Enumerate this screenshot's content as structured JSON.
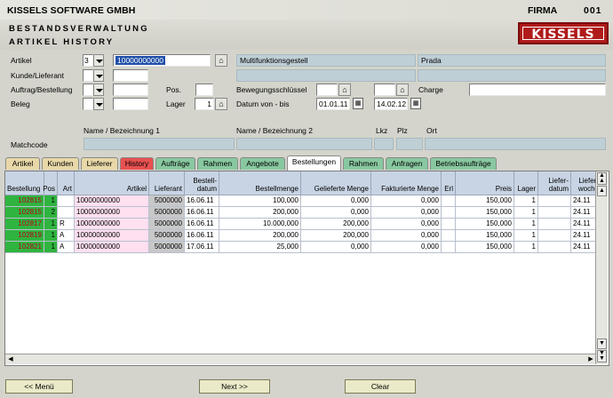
{
  "header": {
    "company": "KISSELS SOFTWARE GMBH",
    "firma_label": "FIRMA",
    "firma_value": "001",
    "module": "BESTANDSVERWALTUNG",
    "screen": "ARTIKEL HISTORY",
    "logo": "KISSELS"
  },
  "form": {
    "artikel_label": "Artikel",
    "artikel_type": "3",
    "artikel_value": "10000000000",
    "artikel_desc": "Multifunktionsgestell",
    "artikel_brand": "Prada",
    "kunde_label": "Kunde/Lieferant",
    "auftrag_label": "Auftrag/Bestellung",
    "pos_label": "Pos.",
    "bewegung_label": "Bewegungsschlüssel",
    "charge_label": "Charge",
    "beleg_label": "Beleg",
    "lager_label": "Lager",
    "lager_value": "1",
    "datum_label": "Datum von - bis",
    "date_from": "01.01.11",
    "date_to": "14.02.12",
    "name1_label": "Name / Bezeichnung 1",
    "name2_label": "Name / Bezeichnung 2",
    "lkz_label": "Lkz",
    "plz_label": "Plz",
    "ort_label": "Ort",
    "matchcode_label": "Matchcode"
  },
  "tabs": [
    {
      "label": "Artikel",
      "color": "#e8d8a8"
    },
    {
      "label": "Kunden",
      "color": "#e8d8a8"
    },
    {
      "label": "Lieferer",
      "color": "#e8d8a8"
    },
    {
      "label": "History",
      "color": "#e85050"
    },
    {
      "label": "Aufträge",
      "color": "#88c8a0"
    },
    {
      "label": "Rahmen",
      "color": "#88c8a0"
    },
    {
      "label": "Angebote",
      "color": "#88c8a0"
    },
    {
      "label": "Bestellungen",
      "color": "#ffffff"
    },
    {
      "label": "Rahmen",
      "color": "#88c8a0"
    },
    {
      "label": "Anfragen",
      "color": "#88c8a0"
    },
    {
      "label": "Betriebsaufträge",
      "color": "#88c8a0"
    }
  ],
  "active_tab": "Bestellungen",
  "table": {
    "columns": [
      "Bestellung",
      "Pos",
      "Art",
      "Artikel",
      "Lieferant",
      "Bestell-\ndatum",
      "Bestellmenge",
      "Gelieferte Menge",
      "Fakturierte Menge",
      "Erl",
      "Preis",
      "Lager",
      "Liefer-\ndatum",
      "Liefer-\nwoche"
    ],
    "rows": [
      [
        "102815",
        "1",
        "",
        "10000000000",
        "5000000",
        "16.06.11",
        "100,000",
        "0,000",
        "0,000",
        "",
        "150,000",
        "1",
        "",
        "24.11"
      ],
      [
        "102815",
        "2",
        "",
        "10000000000",
        "5000000",
        "16.06.11",
        "200,000",
        "0,000",
        "0,000",
        "",
        "150,000",
        "1",
        "",
        "24.11"
      ],
      [
        "102817",
        "1",
        "R",
        "10000000000",
        "5000000",
        "16.06.11",
        "10.000,000",
        "200,000",
        "0,000",
        "",
        "150,000",
        "1",
        "",
        "24.11"
      ],
      [
        "102819",
        "1",
        "A",
        "10000000000",
        "5000000",
        "16.06.11",
        "200,000",
        "200,000",
        "0,000",
        "",
        "150,000",
        "1",
        "",
        "24.11"
      ],
      [
        "102821",
        "1",
        "A",
        "10000000000",
        "5000000",
        "17.06.11",
        "25,000",
        "0,000",
        "0,000",
        "",
        "150,000",
        "1",
        "",
        "24.11"
      ]
    ]
  },
  "buttons": {
    "menu": "<<  Menü",
    "next": "Next >>",
    "clear": "Clear"
  }
}
